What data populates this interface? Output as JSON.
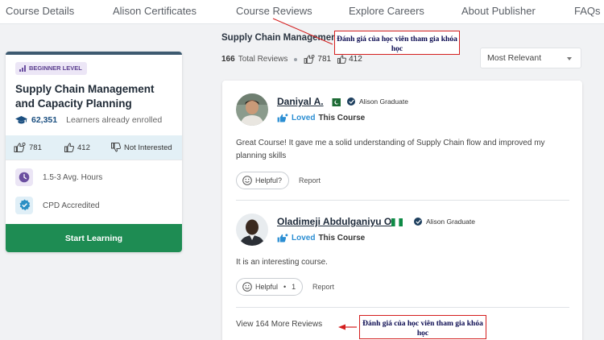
{
  "nav": {
    "items": [
      "Course Details",
      "Alison Certificates",
      "Course Reviews",
      "Explore Careers",
      "About Publisher",
      "FAQs"
    ]
  },
  "course_card": {
    "level_badge": "BEGINNER LEVEL",
    "title": "Supply Chain Management and Capacity Planning",
    "enrolled_count": "62,351",
    "enrolled_label": "Learners already enrolled",
    "likes": "781",
    "thumbs_up": "412",
    "not_interested": "Not Interested",
    "hours": "1.5-3 Avg. Hours",
    "accreditation": "CPD Accredited",
    "start_button": "Start Learning"
  },
  "reviews": {
    "heading": "Supply Chain Management and Capacity Planning",
    "total_count": "166",
    "total_label": "Total Reviews",
    "likes": "781",
    "thumbs_up": "412",
    "sort_selected": "Most Relevant",
    "items": [
      {
        "name": "Daniyal A.",
        "graduate": "Alison Graduate",
        "loved": "Loved",
        "loved_suffix": "This Course",
        "text": "Great Course! It gave me a solid understanding of Supply Chain flow and improved my planning skills",
        "helpful": "Helpful?",
        "report": "Report"
      },
      {
        "name": "Oladimeji Abdulganiyu O.",
        "graduate": "Alison Graduate",
        "loved": "Loved",
        "loved_suffix": "This Course",
        "text": "It is an interesting course.",
        "helpful": "Helpful",
        "helpful_count": "1",
        "report": "Report"
      }
    ],
    "view_more": "View 164 More Reviews"
  },
  "annotations": {
    "top": "Đánh giá của học viên tham gia khóa học",
    "bottom": "Đánh giá của học viên tham gia khóa học"
  },
  "colors": {
    "start_button": "#1e8c53",
    "loved": "#2b8ed3",
    "annotation_border": "#d41e1e",
    "stats_band": "#e3f0f6"
  }
}
